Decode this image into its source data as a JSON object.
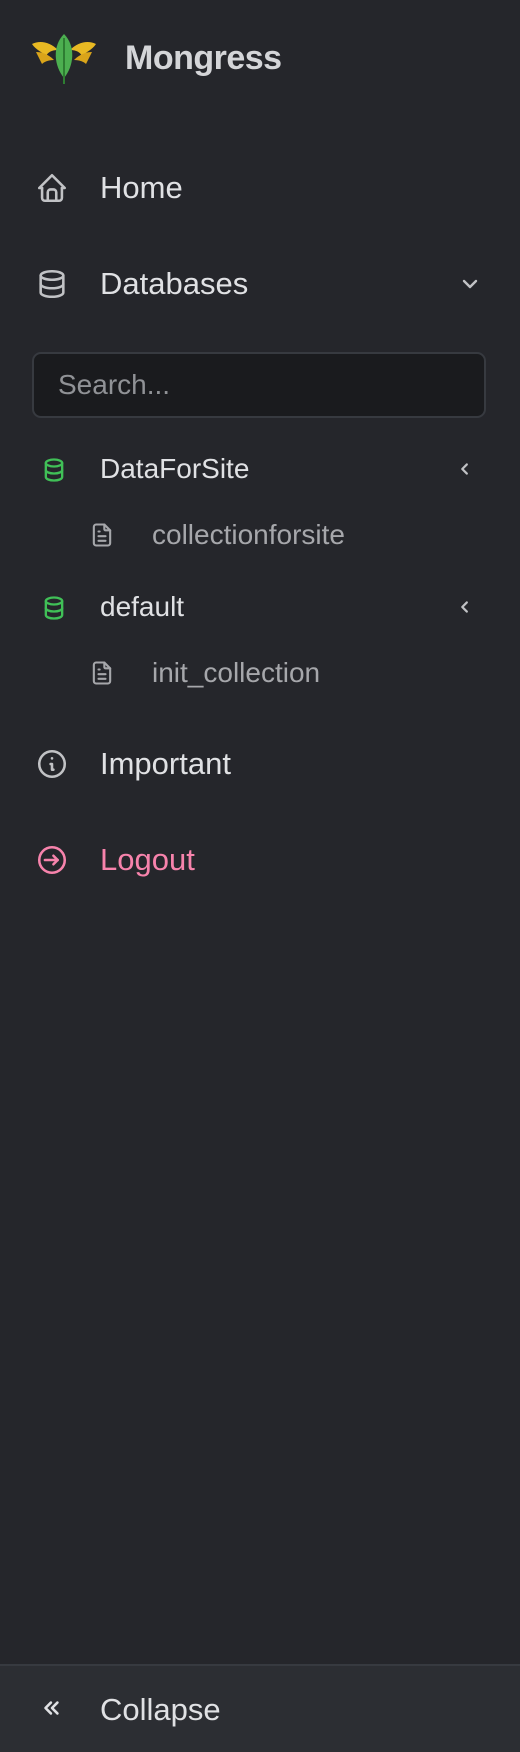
{
  "brand": {
    "name": "Mongress",
    "accent_gold": "#e8b923",
    "accent_leaf": "#4caf50"
  },
  "nav": {
    "home": {
      "label": "Home",
      "icon": "home-icon"
    },
    "databases": {
      "label": "Databases",
      "icon": "database-icon",
      "expanded": true
    },
    "important": {
      "label": "Important",
      "icon": "info-icon"
    },
    "logout": {
      "label": "Logout",
      "icon": "logout-icon",
      "color": "#f783ac"
    }
  },
  "search": {
    "placeholder": "Search...",
    "value": ""
  },
  "databases": [
    {
      "name": "DataForSite",
      "icon_color": "#40c057",
      "collections": [
        "collectionforsite"
      ]
    },
    {
      "name": "default",
      "icon_color": "#40c057",
      "collections": [
        "init_collection"
      ]
    }
  ],
  "footer": {
    "collapse_label": "Collapse"
  }
}
